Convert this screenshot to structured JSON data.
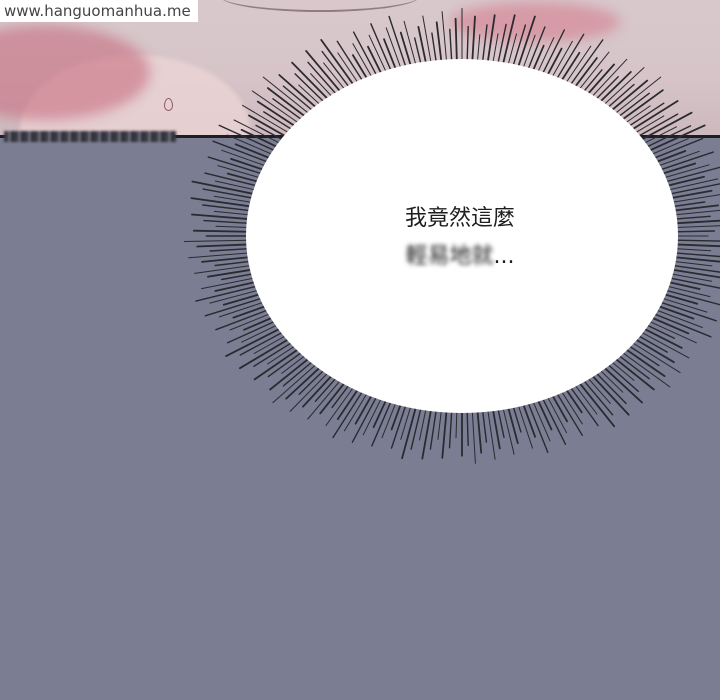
{
  "watermark": {
    "text": "www.hanguomanhua.me"
  },
  "speech_bubble": {
    "line1": "我竟然這麼",
    "line2_obscured": "輕易地就",
    "line2_suffix": "..."
  },
  "colors": {
    "background": "#7b7d93",
    "top_panel": "#d6c4c8",
    "bubble_fill": "#ffffff",
    "burst_lines": "#2a2a30"
  }
}
